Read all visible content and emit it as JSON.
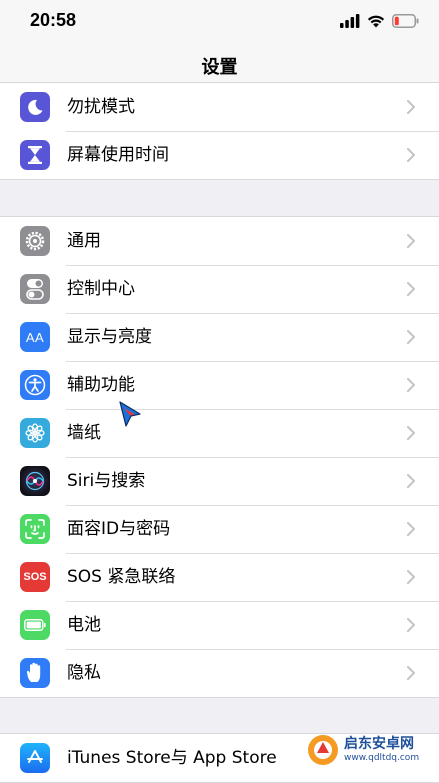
{
  "status_bar": {
    "time": "20:58"
  },
  "nav": {
    "title": "设置"
  },
  "groups": [
    {
      "items": [
        {
          "label": "勿扰模式",
          "icon": "moon-icon",
          "color": "#5856d6"
        },
        {
          "label": "屏幕使用时间",
          "icon": "hourglass-icon",
          "color": "#5856d6"
        }
      ]
    },
    {
      "items": [
        {
          "label": "通用",
          "icon": "gear-icon",
          "color": "#8e8e93"
        },
        {
          "label": "控制中心",
          "icon": "toggles-icon",
          "color": "#8e8e93"
        },
        {
          "label": "显示与亮度",
          "icon": "text-size-icon",
          "color": "#2f7cf6",
          "icon_text": "AA"
        },
        {
          "label": "辅助功能",
          "icon": "accessibility-icon",
          "color": "#2f7cf6"
        },
        {
          "label": "墙纸",
          "icon": "flower-icon",
          "color": "#35aadc"
        },
        {
          "label": "Siri与搜索",
          "icon": "siri-icon",
          "color": "#1c1c2e"
        },
        {
          "label": "面容ID与密码",
          "icon": "face-id-icon",
          "color": "#4cd964"
        },
        {
          "label": "SOS 紧急联络",
          "icon": "sos-icon",
          "color": "#e53935",
          "icon_text": "SOS"
        },
        {
          "label": "电池",
          "icon": "battery-icon",
          "color": "#4cd964"
        },
        {
          "label": "隐私",
          "icon": "hand-icon",
          "color": "#2f7cf6"
        }
      ]
    },
    {
      "items": [
        {
          "label": "iTunes Store与 App Store",
          "icon": "app-store-icon",
          "color": "#2f7cf6"
        }
      ]
    }
  ],
  "watermark": {
    "title": "启东安卓网",
    "url": "www.qdltdq.com"
  }
}
